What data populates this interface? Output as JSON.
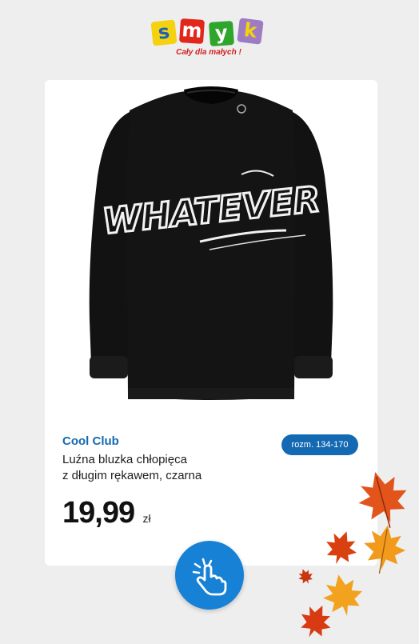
{
  "logo": {
    "letters": [
      "s",
      "m",
      "y",
      "k"
    ],
    "tile_colors": [
      "#f4d20f",
      "#e2261c",
      "#2fa62b",
      "#9e7cc3"
    ],
    "letter_colors": [
      "#1f62b4",
      "#ffffff",
      "#ffffff",
      "#f4d20f"
    ],
    "tagline": "Cały dla małych !"
  },
  "product": {
    "brand": "Cool Club",
    "size": "rozm. 134-170",
    "name_line1": "Luźna bluzka chłopięca",
    "name_line2": "z długim rękawem, czarna",
    "price": "19,99",
    "currency": "zł",
    "image_icon": "black-sweatshirt-graffiti-print",
    "graffiti_text": "WHATEVER"
  },
  "cta": {
    "icon": "tap-hand-icon"
  },
  "decor": {
    "icon": "autumn-leaves"
  },
  "colors": {
    "accent": "#1469b3",
    "button": "#1781d6",
    "background": "#eeeeef"
  }
}
